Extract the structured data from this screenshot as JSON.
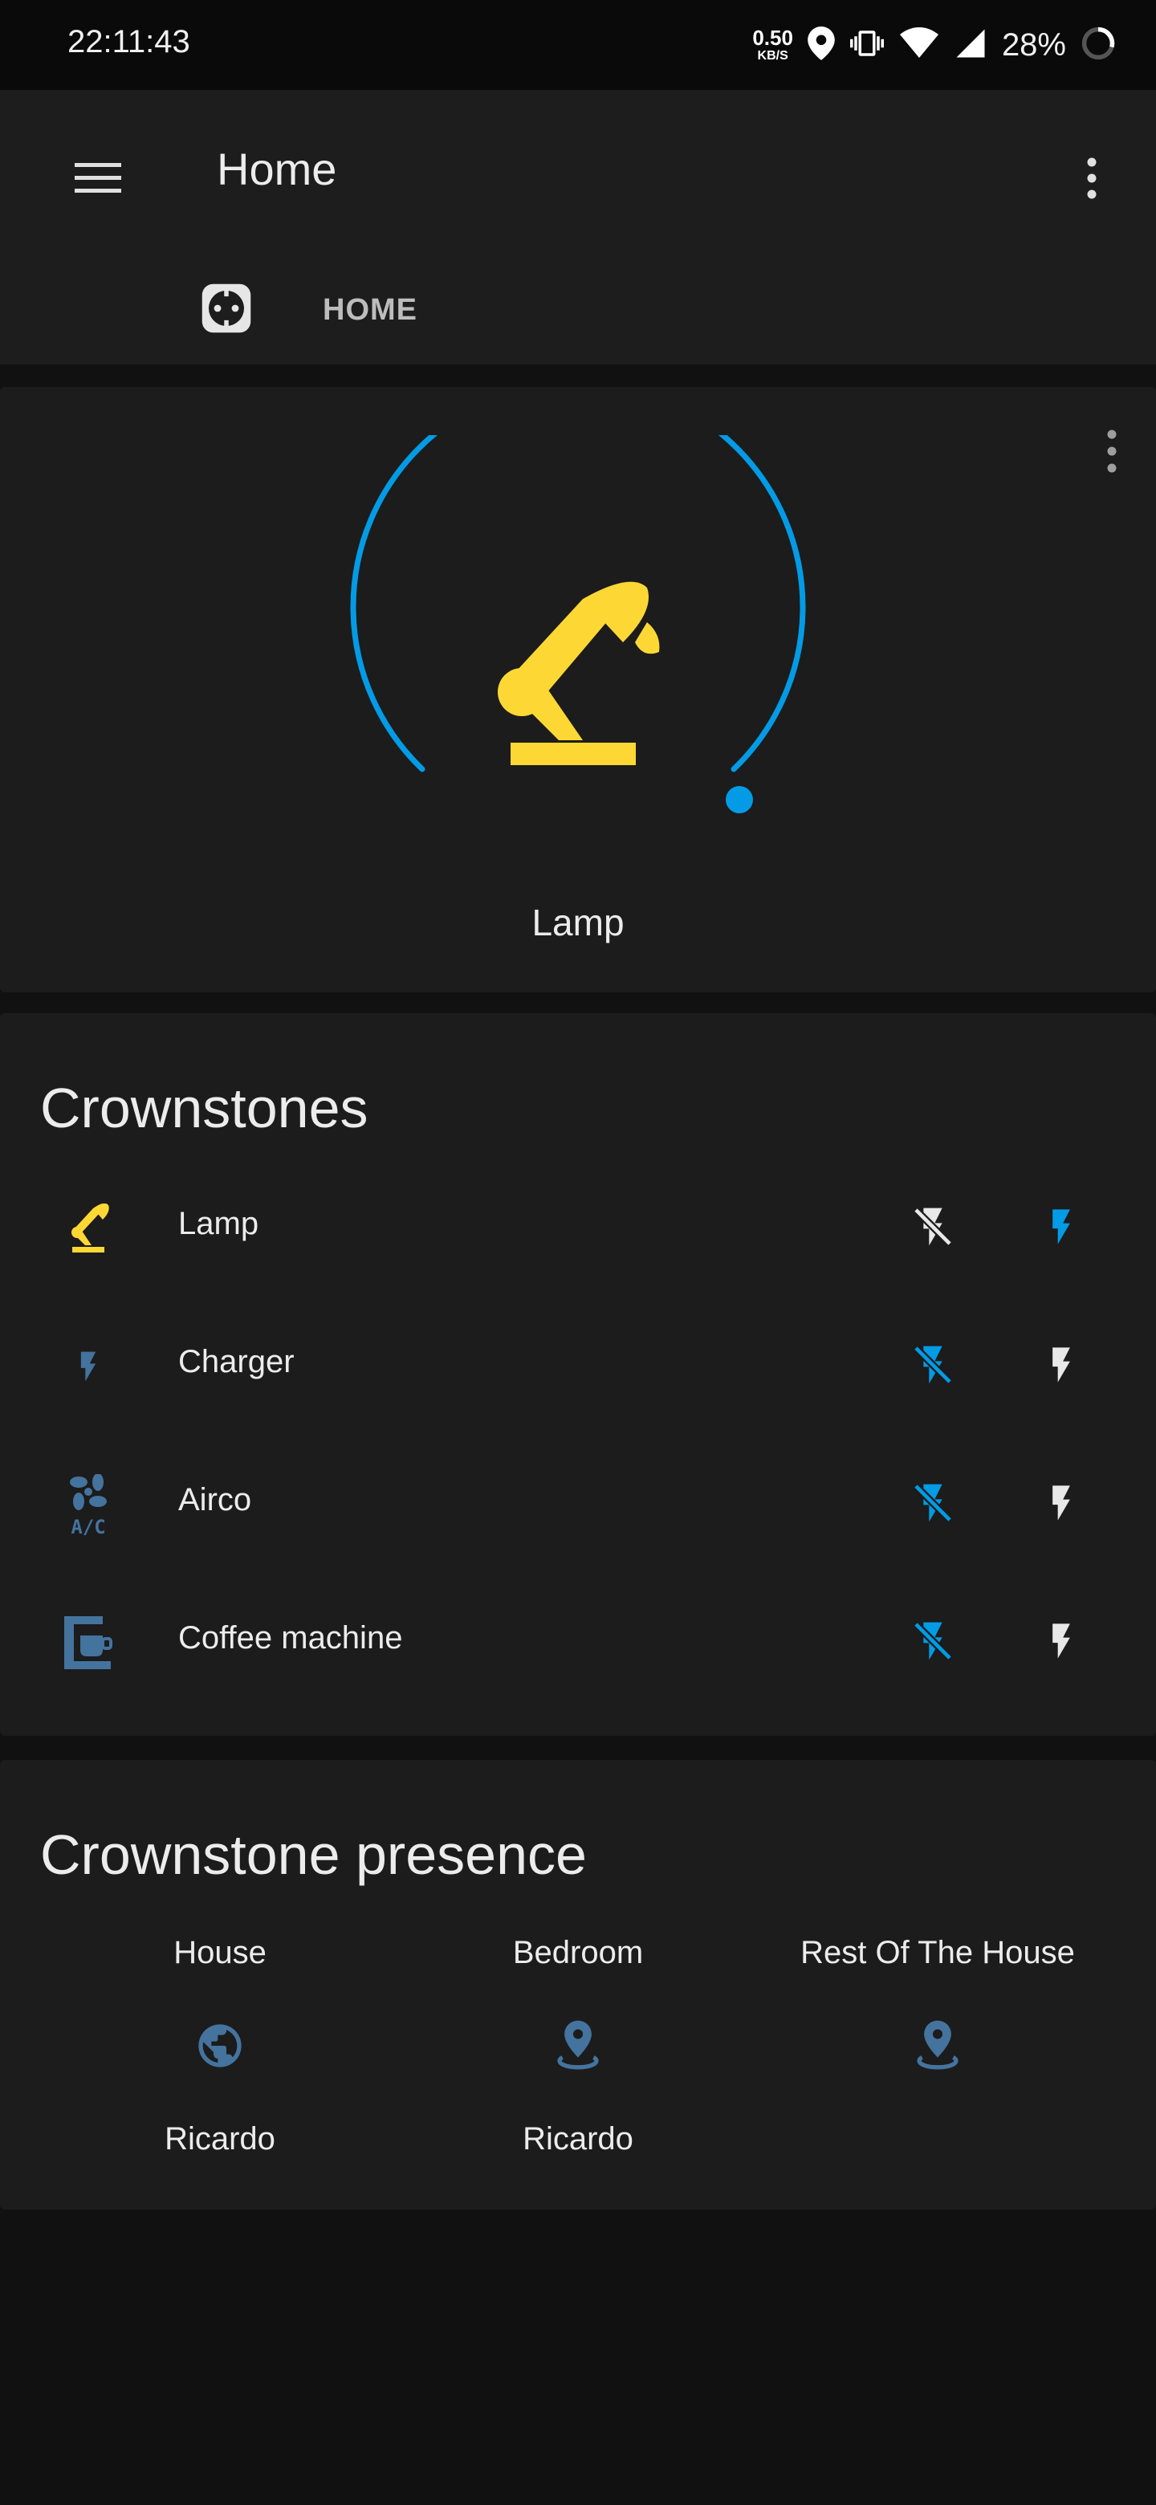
{
  "status_bar": {
    "time": "22:11:43",
    "net_speed": "0.50",
    "net_unit": "KB/S",
    "battery": "28%",
    "icons": [
      "location-icon",
      "vibrate-icon",
      "wifi-icon",
      "signal-icon",
      "battery-icon"
    ]
  },
  "app_bar": {
    "title": "Home",
    "menu_icon": "hamburger-menu-icon",
    "overflow_icon": "more-vert-icon"
  },
  "tabs": [
    {
      "icon": "power-socket-icon",
      "selected": true
    },
    {
      "label": "HOME",
      "selected": false
    }
  ],
  "gauge_card": {
    "label": "Lamp",
    "icon": "desk-lamp-icon",
    "value_fraction": 1.0,
    "colors": {
      "arc": "#039be5",
      "icon": "#fdd835"
    }
  },
  "crownstones": {
    "title": "Crownstones",
    "items": [
      {
        "label": "Lamp",
        "icon": "desk-lamp-icon",
        "state": "on"
      },
      {
        "label": "Charger",
        "icon": "flash-icon",
        "state": "off"
      },
      {
        "label": "Airco",
        "icon": "air-conditioner-icon",
        "state": "off"
      },
      {
        "label": "Coffee machine",
        "icon": "coffee-maker-icon",
        "state": "off"
      }
    ],
    "off_icon": "flash-off-icon",
    "on_icon": "flash-icon"
  },
  "presence": {
    "title": "Crownstone presence",
    "areas": [
      {
        "area": "House",
        "icon": "earth-icon",
        "person": "Ricardo"
      },
      {
        "area": "Bedroom",
        "icon": "map-marker-icon",
        "person": "Ricardo"
      },
      {
        "area": "Rest Of The House",
        "icon": "map-marker-icon",
        "person": ""
      }
    ]
  },
  "colors": {
    "active_blue": "#039be5",
    "lamp_yellow": "#fdd835",
    "inactive_icon": "#44739e",
    "text": "#e1e1e1",
    "card_bg": "#1c1c1c",
    "page_bg": "#111111"
  }
}
